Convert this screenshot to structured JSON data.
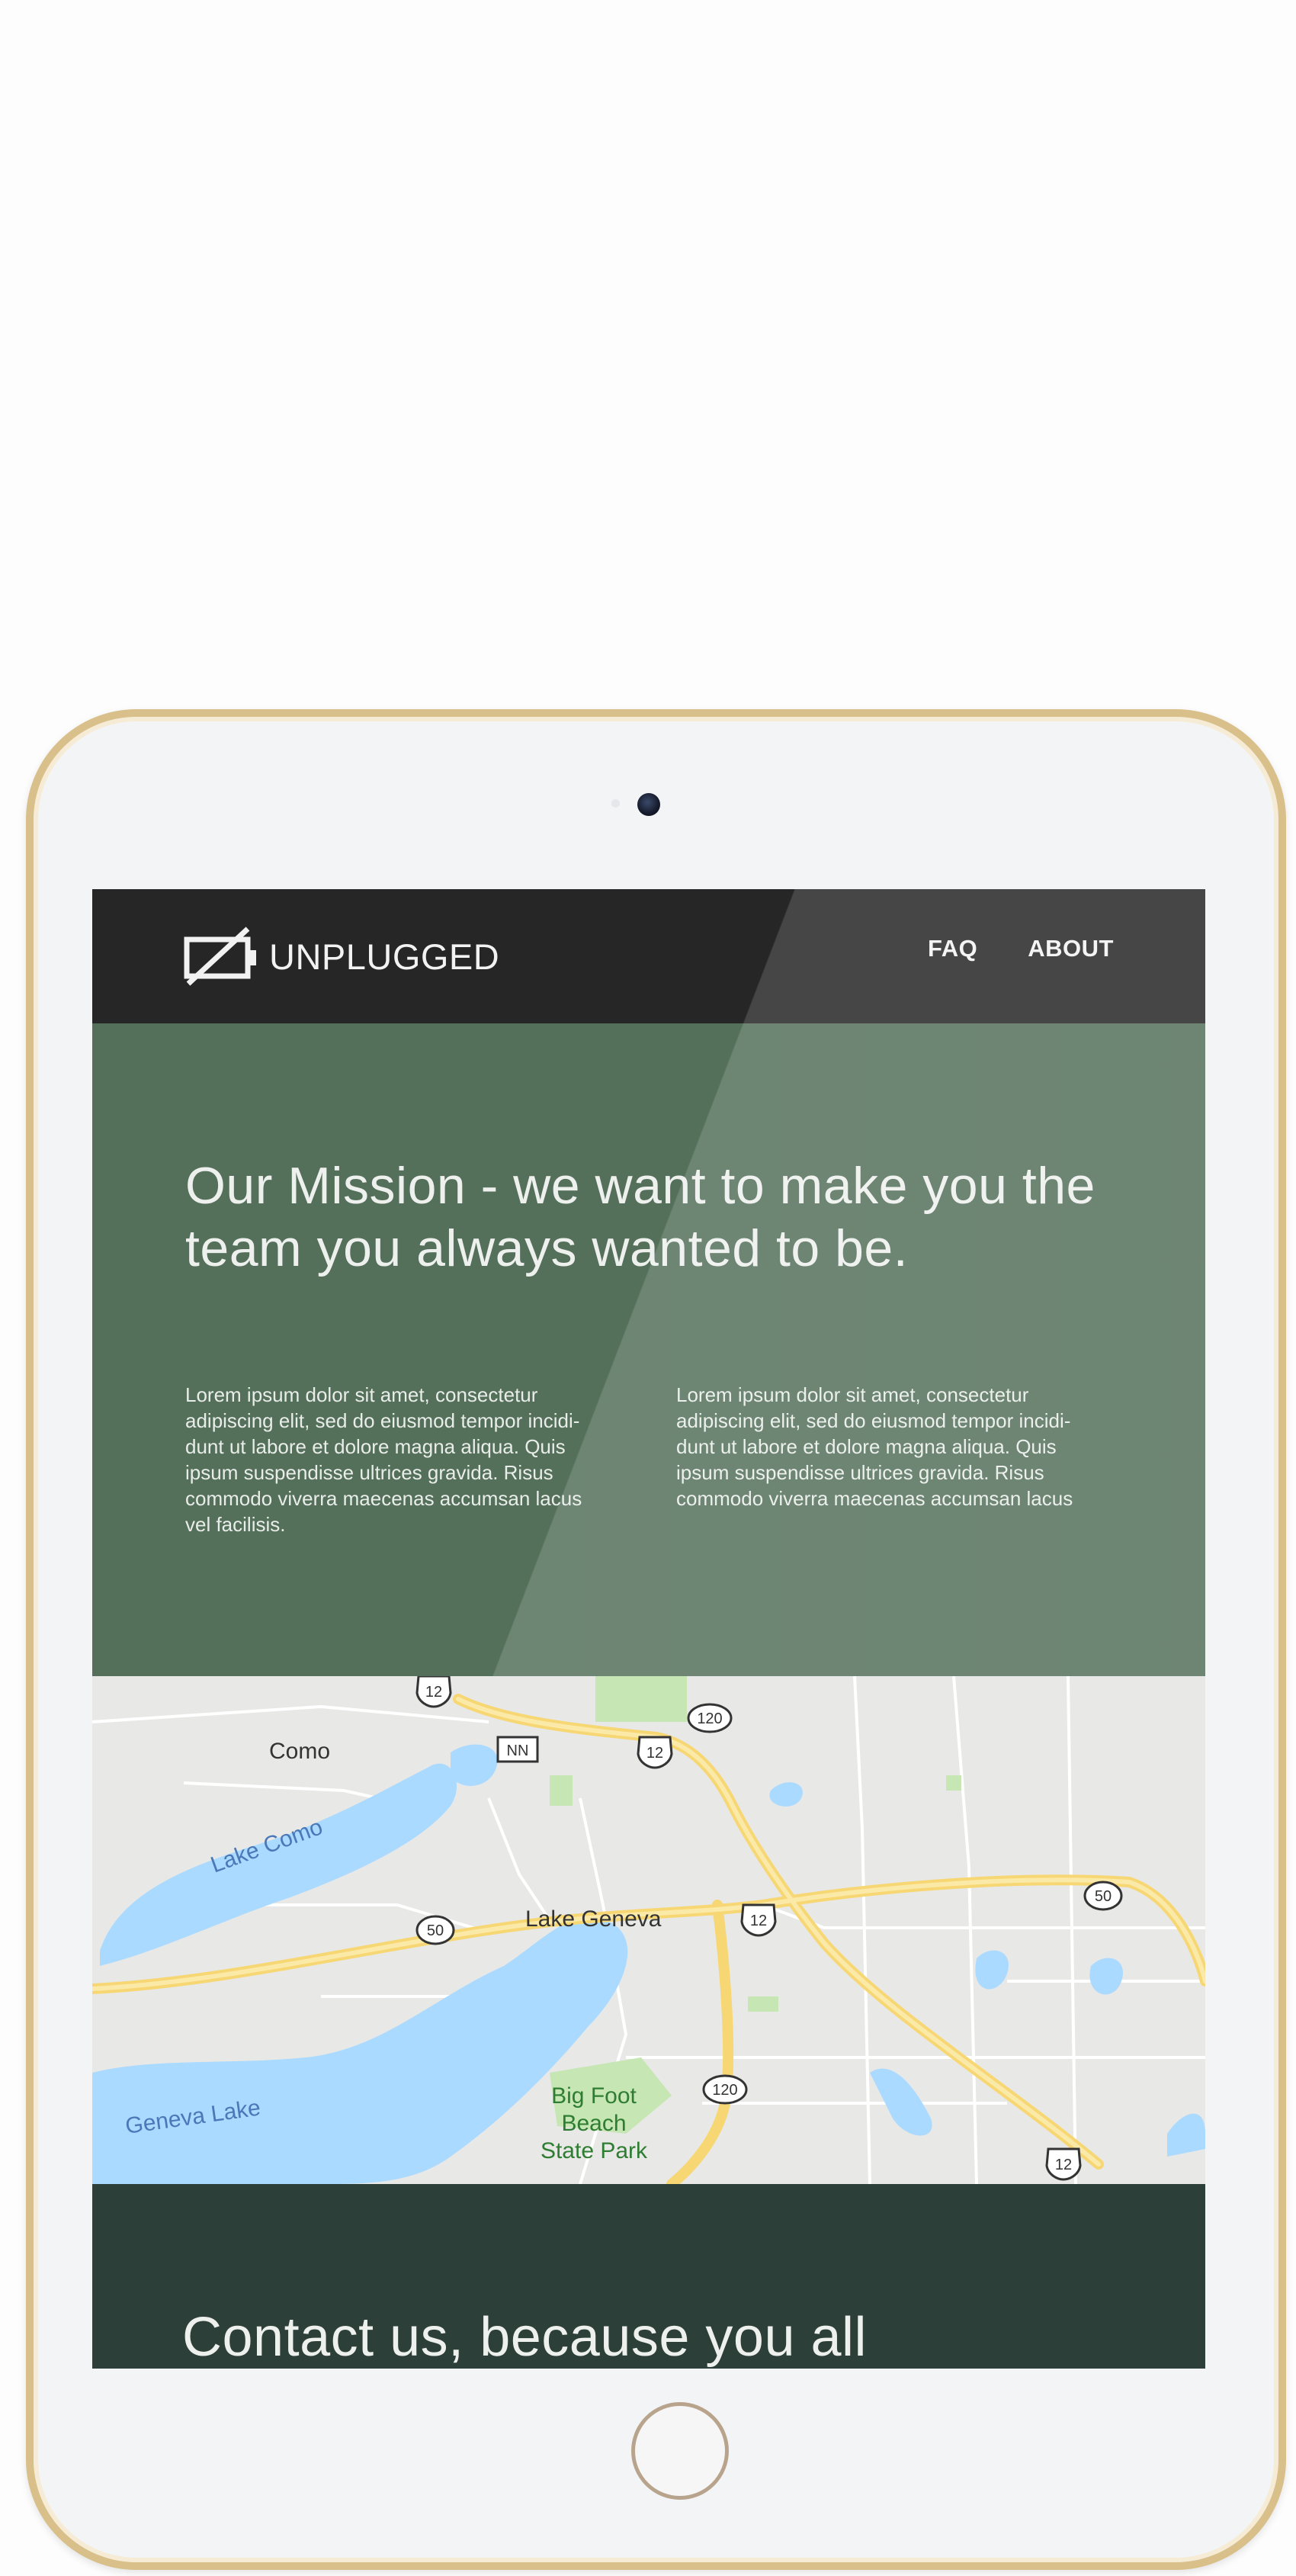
{
  "nav": {
    "brand": "UNPLUGGED",
    "brand_icon": "battery-off-icon",
    "links": [
      "FAQ",
      "ABOUT"
    ]
  },
  "hero": {
    "title": "Our Mission - we want to make you the team you always wanted to be.",
    "col_left": "Lorem ipsum dolor sit amet, consectetur adipiscing elit, sed do eiusmod tempor incidi-dunt ut labore et dolore magna aliqua. Quis ipsum suspendisse ultrices gravida. Risus commodo viverra maecenas accumsan lacus vel facilisis.",
    "col_right": "Lorem ipsum dolor sit amet, consectetur adipiscing elit, sed do eiusmod tempor incidi-dunt ut labore et dolore magna aliqua. Quis ipsum suspendisse ultrices gravida. Risus commodo viverra maecenas accumsan lacus"
  },
  "map": {
    "places": {
      "como": "Como",
      "lake_como": "Lake Como",
      "lake_geneva_town": "Lake Geneva",
      "geneva_lake": "Geneva Lake",
      "park_line1": "Big Foot",
      "park_line2": "Beach",
      "park_line3": "State Park"
    },
    "shields": {
      "us12": "12",
      "r120": "120",
      "r50": "50",
      "nn": "NN"
    }
  },
  "contact": {
    "title": "Contact us, because you all"
  },
  "colors": {
    "nav_bg": "#262626",
    "hero_bg": "#54705a",
    "contact_bg": "#2c4039",
    "device_frame": "#d9c08a",
    "water": "#aadaff",
    "highway": "#f9dc7a"
  }
}
